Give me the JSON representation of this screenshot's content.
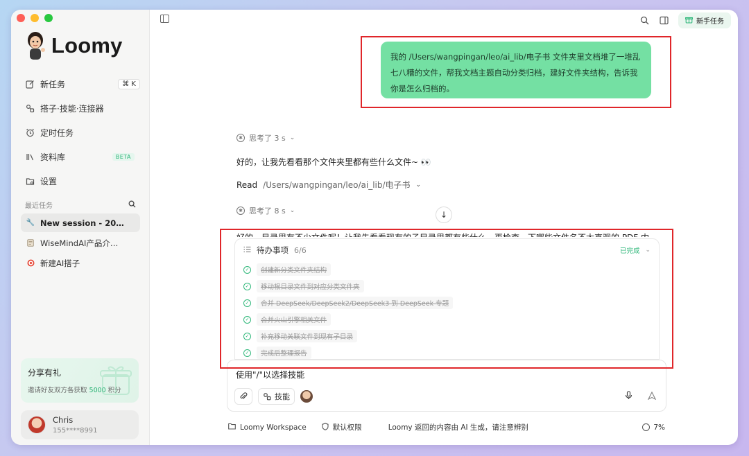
{
  "app": {
    "brand_name": "Loomy",
    "accent_color": "#2fb77a",
    "bubble_color": "#74e0a3"
  },
  "sidebar": {
    "items": [
      {
        "label": "新任务",
        "icon": "edit-icon",
        "shortcut": "⌘ K"
      },
      {
        "label": "搭子·技能·连接器",
        "icon": "link-icon"
      },
      {
        "label": "定时任务",
        "icon": "alarm-icon"
      },
      {
        "label": "资料库",
        "icon": "library-icon",
        "badge": "BETA"
      },
      {
        "label": "设置",
        "icon": "settings-icon"
      }
    ],
    "recent_title": "最近任务",
    "recent": [
      {
        "label": "New session - 20…",
        "icon": "wrench-icon",
        "active": true
      },
      {
        "label": "WiseMindAI产品介…",
        "icon": "document-icon"
      },
      {
        "label": "新建AI搭子",
        "icon": "target-icon"
      }
    ],
    "share": {
      "title": "分享有礼",
      "desc_prefix": "邀请好友双方各获取",
      "desc_highlight": "5000",
      "desc_suffix": "积分"
    },
    "user": {
      "name": "Chris",
      "phone": "155****8991"
    }
  },
  "header": {
    "new_task_label": "新手任务"
  },
  "conversation": {
    "user_message": "我的 /Users/wangpingan/leo/ai_lib/电子书 文件夹里文档堆了一堆乱七八糟的文件，帮我文档主题自动分类归档，建好文件夹结构，告诉我你是怎么归档的。",
    "think_1": "思考了 3 s",
    "reply_1": "好的，让我先看看那个文件夹里都有些什么文件~ 👀",
    "read_verb": "Read",
    "read_path": "/Users/wangpingan/leo/ai_lib/电子书",
    "think_2": "思考了 8 s",
    "partial_text": "好的，目录里有不少文件呢！让我先看看现有的子目录里都有些什么，再检查一下哪些文件名不太直观的 PDF 内"
  },
  "todo": {
    "title": "待办事项",
    "count": "6/6",
    "status": "已完成",
    "items": [
      "创建新分类文件夹结构",
      "移动根目录文件到对应分类文件夹",
      "合并 DeepSeek/DeepSeek2/DeepSeek3 到 DeepSeek 专题",
      "合并火山引擎相关文件",
      "补充移动关联文件到现有子目录",
      "完成后整理报告"
    ]
  },
  "composer": {
    "placeholder": "使用\"/\"以选择技能",
    "skills_label": "技能"
  },
  "footer": {
    "workspace": "Loomy Workspace",
    "permission": "默认权限",
    "disclaimer": "Loomy 返回的内容由 AI 生成，请注意辨别",
    "usage": "7%"
  }
}
